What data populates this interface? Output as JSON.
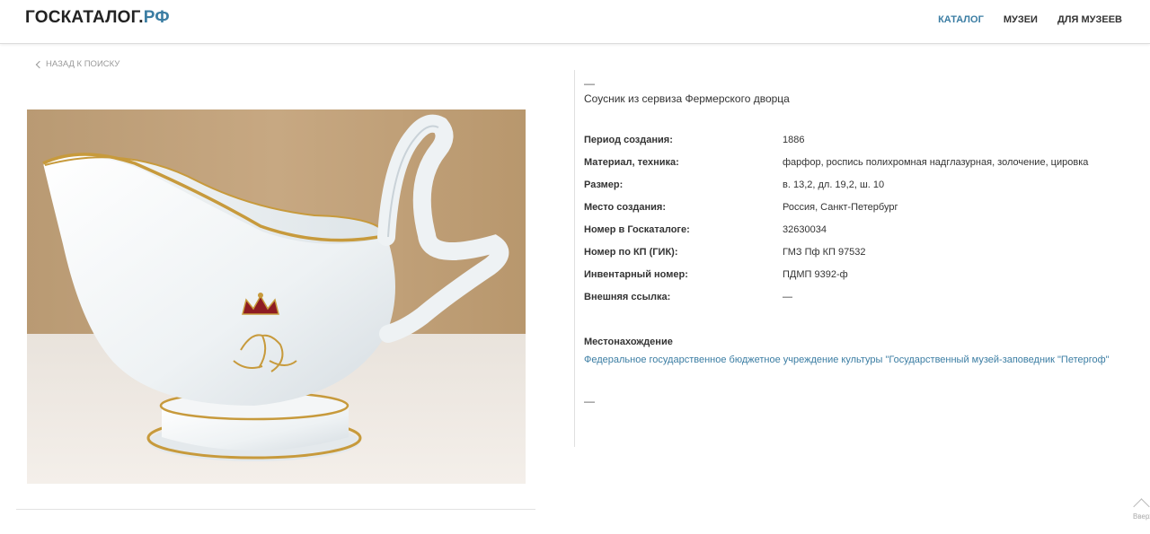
{
  "header": {
    "logo_main": "ГОСКАТАЛОГ.",
    "logo_accent": "РФ",
    "nav": [
      {
        "label": "КАТАЛОГ",
        "active": true
      },
      {
        "label": "МУЗЕИ",
        "active": false
      },
      {
        "label": "ДЛЯ МУЗЕЕВ",
        "active": false
      }
    ]
  },
  "back_link": "НАЗАД К ПОИСКУ",
  "object": {
    "dash_top": "—",
    "title": "Соусник из сервиза Фермерского дворца",
    "properties": [
      {
        "label": "Период создания:",
        "value": "1886"
      },
      {
        "label": "Материал, техника:",
        "value": "фарфор, роспись полихромная надглазурная, золочение, цировка"
      },
      {
        "label": "Размер:",
        "value": "в. 13,2, дл. 19,2, ш. 10"
      },
      {
        "label": "Место создания:",
        "value": "Россия, Санкт-Петербург"
      },
      {
        "label": "Номер в Госкаталоге:",
        "value": "32630034"
      },
      {
        "label": "Номер по КП (ГИК):",
        "value": "ГМЗ Пф КП 97532"
      },
      {
        "label": "Инвентарный номер:",
        "value": "ПДМП 9392-ф"
      },
      {
        "label": "Внешняя ссылка:",
        "value": "—"
      }
    ],
    "location_label": "Местонахождение",
    "location_value": "Федеральное государственное бюджетное учреждение культуры \"Государственный музей-заповедник \"Петергоф\"",
    "dash_bottom": "—"
  },
  "to_top_label": "Вверх",
  "colors": {
    "accent": "#3b7da3",
    "background": "#ffffff"
  }
}
